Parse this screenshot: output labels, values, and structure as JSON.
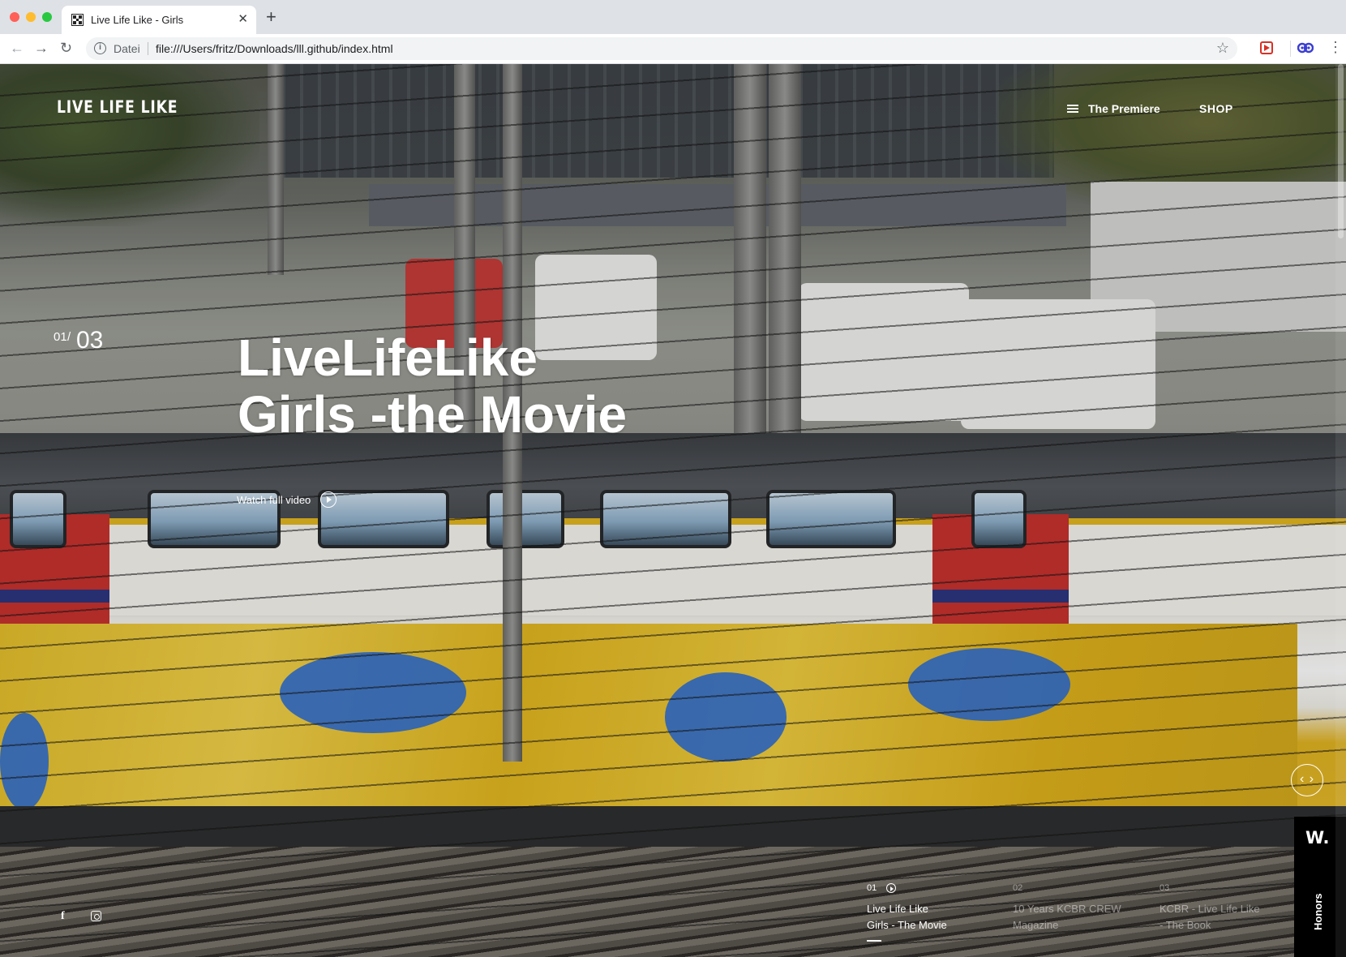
{
  "browser": {
    "tab_title": "Live Life Like - Girls",
    "tab_close": "✕",
    "new_tab": "+",
    "scheme_label": "Datei",
    "url": "file:///Users/fritz/Downloads/lll.github/index.html",
    "back": "←",
    "forward": "→",
    "reload": "↻",
    "bookmark": "☆",
    "menu": "⋮"
  },
  "site": {
    "logo": "LIVE LIFE LIKE",
    "nav": {
      "premiere_label": "The Premiere",
      "shop_label": "SHOP"
    },
    "hero": {
      "counter_current": "01",
      "counter_sep": "/",
      "counter_total": "03",
      "title_line1": "LiveLifeLike",
      "title_line2": "Girls -the Movie",
      "watch_label": "Watch full video"
    },
    "slider_arrows": "‹ ›",
    "social": {
      "facebook": "f"
    },
    "slides": [
      {
        "num": "01",
        "label_line1": "Live Life Like",
        "label_line2": "Girls - The Movie"
      },
      {
        "num": "02",
        "label_line1": "10 Years KCBR CREW",
        "label_line2": "Magazine"
      },
      {
        "num": "03",
        "label_line1": "KCBR - Live Life Like",
        "label_line2": "- The Book"
      }
    ],
    "honors": {
      "badge": "W.",
      "label": "Honors"
    }
  },
  "colors": {
    "tabbar_bg": "#dee1e6",
    "honors_bg": "#000000",
    "text_on_hero": "#ffffff"
  },
  "icons": [
    "favicon-icon",
    "info-icon",
    "star-icon",
    "extension-red-icon",
    "extension-blue-icon",
    "menu-icon",
    "burger-menu-icon",
    "play-circle-icon",
    "slider-arrows-icon",
    "facebook-icon",
    "instagram-icon"
  ]
}
